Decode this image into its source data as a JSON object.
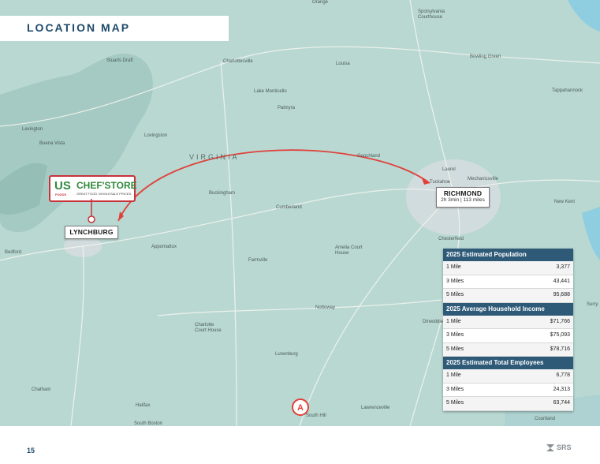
{
  "header": {
    "title": "LOCATION MAP"
  },
  "places": [
    {
      "id": "orange",
      "label": "Orange"
    },
    {
      "id": "spotsylvania",
      "label": "Spotsylvania\nCourthouse"
    },
    {
      "id": "stuarts-draft",
      "label": "Stuarts Draft"
    },
    {
      "id": "charlottesville",
      "label": "Charlottesville"
    },
    {
      "id": "louisa",
      "label": "Louisa"
    },
    {
      "id": "bowling-green",
      "label": "Bowling Green"
    },
    {
      "id": "tappahannock",
      "label": "Tappahannock"
    },
    {
      "id": "lake-monticello",
      "label": "Lake Monticello"
    },
    {
      "id": "palmyra",
      "label": "Palmyra"
    },
    {
      "id": "lexington",
      "label": "Lexington"
    },
    {
      "id": "lovingston",
      "label": "Lovingston"
    },
    {
      "id": "buena-vista",
      "label": "Buena Vista"
    },
    {
      "id": "virginia",
      "label": "VIRGINIA"
    },
    {
      "id": "goochland",
      "label": "Goochland"
    },
    {
      "id": "laurel",
      "label": "Laurel"
    },
    {
      "id": "mechanicsville",
      "label": "Mechanicsville"
    },
    {
      "id": "tuckahoe",
      "label": "Tuckahoe"
    },
    {
      "id": "buckingham",
      "label": "Buckingham"
    },
    {
      "id": "cumberland",
      "label": "Cumberland"
    },
    {
      "id": "new-kent",
      "label": "New Kent"
    },
    {
      "id": "chesterfield",
      "label": "Chesterfield"
    },
    {
      "id": "bedford",
      "label": "Bedford"
    },
    {
      "id": "appomattox",
      "label": "Appomattox"
    },
    {
      "id": "amelia",
      "label": "Amelia Court\nHouse"
    },
    {
      "id": "farmville",
      "label": "Farmville"
    },
    {
      "id": "nottoway",
      "label": "Nottoway"
    },
    {
      "id": "dinwiddie",
      "label": "Dinwiddie"
    },
    {
      "id": "surry",
      "label": "Surry"
    },
    {
      "id": "charlotte",
      "label": "Charlotte\nCourt House"
    },
    {
      "id": "lunenburg",
      "label": "Lunenburg"
    },
    {
      "id": "chatham",
      "label": "Chatham"
    },
    {
      "id": "halifax",
      "label": "Halifax"
    },
    {
      "id": "south-boston",
      "label": "South Boston"
    },
    {
      "id": "south-hill",
      "label": "South Hill"
    },
    {
      "id": "lawrenceville",
      "label": "Lawrenceville"
    },
    {
      "id": "courtland",
      "label": "Courtland"
    }
  ],
  "logo": {
    "brand": "US",
    "brand_sub": "FOODS",
    "name": "CHEF'STORE",
    "tagline": "GREAT FOOD. WHOLESALE PRICES."
  },
  "lynchburg": {
    "label": "LYNCHBURG"
  },
  "richmond": {
    "label": "RICHMOND",
    "distance": "2h 3min | 113 miles"
  },
  "stats": [
    {
      "heading": "2025 Estimated Population",
      "rows": [
        {
          "label": "1 Mile",
          "value": "3,377"
        },
        {
          "label": "3 Miles",
          "value": "43,441"
        },
        {
          "label": "5 Miles",
          "value": "95,688"
        }
      ]
    },
    {
      "heading": "2025 Average Household Income",
      "rows": [
        {
          "label": "1 Mile",
          "value": "$71,766"
        },
        {
          "label": "3 Miles",
          "value": "$75,093"
        },
        {
          "label": "5 Miles",
          "value": "$78,716"
        }
      ]
    },
    {
      "heading": "2025 Estimated Total Employees",
      "rows": [
        {
          "label": "1 Mile",
          "value": "6,778"
        },
        {
          "label": "3 Miles",
          "value": "24,313"
        },
        {
          "label": "5 Miles",
          "value": "63,744"
        }
      ]
    }
  ],
  "footer": {
    "page_number": "15",
    "brand": "SRS"
  },
  "colors": {
    "accent": "#1e4a6b",
    "route": "#e0413a",
    "table_header": "#2e5a78",
    "map_land": "#b9d8d2"
  }
}
